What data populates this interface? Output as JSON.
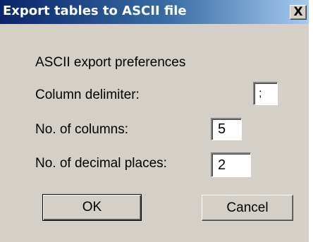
{
  "window": {
    "title": "Export tables to ASCII file",
    "close_glyph": "X"
  },
  "form": {
    "section_heading": "ASCII export preferences",
    "column_delimiter": {
      "label": "Column delimiter:",
      "value": ";"
    },
    "num_columns": {
      "label": "No. of columns:",
      "value": "5"
    },
    "decimal_places": {
      "label": "No. of decimal places:",
      "value": "2"
    }
  },
  "buttons": {
    "ok_label": "OK",
    "cancel_label": "Cancel"
  }
}
